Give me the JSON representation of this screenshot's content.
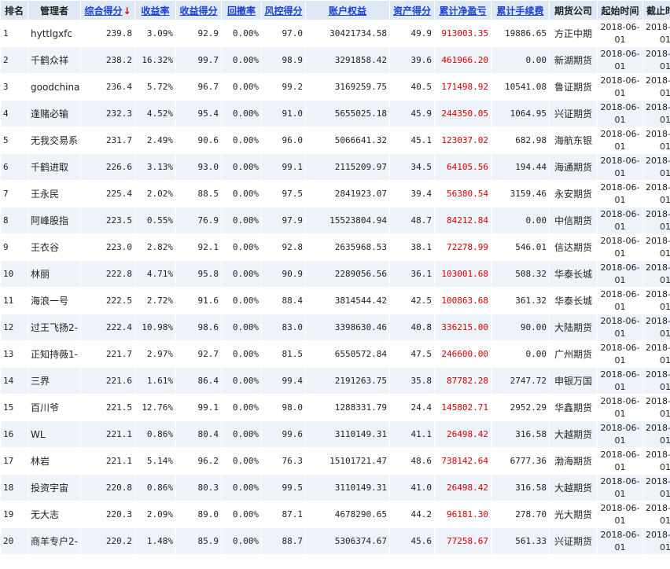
{
  "headers": {
    "rank": "排名",
    "manager": "管理者",
    "score": "综合得分",
    "sort_arrow": "↓",
    "return": "收益率",
    "return_score": "收益得分",
    "drawdown": "回撤率",
    "risk_score": "风控得分",
    "equity": "账户权益",
    "asset_score": "资产得分",
    "net_profit": "累计净盈亏",
    "fees": "累计手续费",
    "company": "期货公司",
    "start": "起始时间",
    "end": "截止时间"
  },
  "rows": [
    {
      "rank": "1",
      "manager": "hyttlgxfc",
      "score": "239.8",
      "ret": "3.09%",
      "ret_score": "92.9",
      "dd": "0.00%",
      "risk": "97.0",
      "equity": "30421734.58",
      "asset": "49.9",
      "profit": "913003.35",
      "fee": "19886.65",
      "company": "方正中期",
      "start": "2018-06-01",
      "end": "2018-06-01"
    },
    {
      "rank": "2",
      "manager": "千鹤众祥",
      "score": "238.2",
      "ret": "16.32%",
      "ret_score": "99.7",
      "dd": "0.00%",
      "risk": "98.9",
      "equity": "3291858.42",
      "asset": "39.6",
      "profit": "461966.20",
      "fee": "0.00",
      "company": "新湖期货",
      "start": "2018-06-01",
      "end": "2018-06-01"
    },
    {
      "rank": "3",
      "manager": "goodchinas",
      "score": "236.4",
      "ret": "5.72%",
      "ret_score": "96.7",
      "dd": "0.00%",
      "risk": "99.2",
      "equity": "3169259.75",
      "asset": "40.5",
      "profit": "171498.92",
      "fee": "10541.08",
      "company": "鲁证期货",
      "start": "2018-06-01",
      "end": "2018-06-01"
    },
    {
      "rank": "4",
      "manager": "逢赌必输",
      "score": "232.3",
      "ret": "4.52%",
      "ret_score": "95.4",
      "dd": "0.00%",
      "risk": "91.0",
      "equity": "5655025.18",
      "asset": "45.9",
      "profit": "244350.05",
      "fee": "1064.95",
      "company": "兴证期货",
      "start": "2018-06-01",
      "end": "2018-06-01"
    },
    {
      "rank": "5",
      "manager": "无我交易系",
      "score": "231.7",
      "ret": "2.49%",
      "ret_score": "90.6",
      "dd": "0.00%",
      "risk": "96.0",
      "equity": "5066641.32",
      "asset": "45.1",
      "profit": "123037.02",
      "fee": "682.98",
      "company": "海航东银",
      "start": "2018-06-01",
      "end": "2018-06-01"
    },
    {
      "rank": "6",
      "manager": "千鹤进取",
      "score": "226.6",
      "ret": "3.13%",
      "ret_score": "93.0",
      "dd": "0.00%",
      "risk": "99.1",
      "equity": "2115209.97",
      "asset": "34.5",
      "profit": "64105.56",
      "fee": "194.44",
      "company": "海通期货",
      "start": "2018-06-01",
      "end": "2018-06-01"
    },
    {
      "rank": "7",
      "manager": "王永民",
      "score": "225.4",
      "ret": "2.02%",
      "ret_score": "88.5",
      "dd": "0.00%",
      "risk": "97.5",
      "equity": "2841923.07",
      "asset": "39.4",
      "profit": "56380.54",
      "fee": "3159.46",
      "company": "永安期货",
      "start": "2018-06-01",
      "end": "2018-06-01"
    },
    {
      "rank": "8",
      "manager": "阿峰股指",
      "score": "223.5",
      "ret": "0.55%",
      "ret_score": "76.9",
      "dd": "0.00%",
      "risk": "97.9",
      "equity": "15523804.94",
      "asset": "48.7",
      "profit": "84212.84",
      "fee": "0.00",
      "company": "中信期货",
      "start": "2018-06-01",
      "end": "2018-06-01"
    },
    {
      "rank": "9",
      "manager": "王衣谷",
      "score": "223.0",
      "ret": "2.82%",
      "ret_score": "92.1",
      "dd": "0.00%",
      "risk": "92.8",
      "equity": "2635968.53",
      "asset": "38.1",
      "profit": "72278.99",
      "fee": "546.01",
      "company": "信达期货",
      "start": "2018-06-01",
      "end": "2018-06-01"
    },
    {
      "rank": "10",
      "manager": "林丽",
      "score": "222.8",
      "ret": "4.71%",
      "ret_score": "95.8",
      "dd": "0.00%",
      "risk": "90.9",
      "equity": "2289056.56",
      "asset": "36.1",
      "profit": "103001.68",
      "fee": "508.32",
      "company": "华泰长城",
      "start": "2018-06-01",
      "end": "2018-06-01"
    },
    {
      "rank": "11",
      "manager": "海浪一号",
      "score": "222.5",
      "ret": "2.72%",
      "ret_score": "91.6",
      "dd": "0.00%",
      "risk": "88.4",
      "equity": "3814544.42",
      "asset": "42.5",
      "profit": "100863.68",
      "fee": "361.32",
      "company": "华泰长城",
      "start": "2018-06-01",
      "end": "2018-06-01"
    },
    {
      "rank": "12",
      "manager": "过王飞扬2-",
      "score": "222.4",
      "ret": "10.98%",
      "ret_score": "98.6",
      "dd": "0.00%",
      "risk": "83.0",
      "equity": "3398630.46",
      "asset": "40.8",
      "profit": "336215.00",
      "fee": "90.00",
      "company": "大陆期货",
      "start": "2018-06-01",
      "end": "2018-06-01"
    },
    {
      "rank": "13",
      "manager": "正知持薇1-",
      "score": "221.7",
      "ret": "2.97%",
      "ret_score": "92.7",
      "dd": "0.00%",
      "risk": "81.5",
      "equity": "6550572.84",
      "asset": "47.5",
      "profit": "246600.00",
      "fee": "0.00",
      "company": "广州期货",
      "start": "2018-06-01",
      "end": "2018-06-01"
    },
    {
      "rank": "14",
      "manager": "三界",
      "score": "221.6",
      "ret": "1.61%",
      "ret_score": "86.4",
      "dd": "0.00%",
      "risk": "99.4",
      "equity": "2191263.75",
      "asset": "35.8",
      "profit": "87782.28",
      "fee": "2747.72",
      "company": "申银万国",
      "start": "2018-06-01",
      "end": "2018-06-01"
    },
    {
      "rank": "15",
      "manager": "百川爷",
      "score": "221.5",
      "ret": "12.76%",
      "ret_score": "99.1",
      "dd": "0.00%",
      "risk": "98.0",
      "equity": "1288331.79",
      "asset": "24.4",
      "profit": "145802.71",
      "fee": "2952.29",
      "company": "华鑫期货",
      "start": "2018-06-01",
      "end": "2018-06-01"
    },
    {
      "rank": "16",
      "manager": "WL",
      "score": "221.1",
      "ret": "0.86%",
      "ret_score": "80.4",
      "dd": "0.00%",
      "risk": "99.6",
      "equity": "3110149.31",
      "asset": "41.1",
      "profit": "26498.42",
      "fee": "316.58",
      "company": "大越期货",
      "start": "2018-06-01",
      "end": "2018-06-01"
    },
    {
      "rank": "17",
      "manager": "林岩",
      "score": "221.1",
      "ret": "5.14%",
      "ret_score": "96.2",
      "dd": "0.00%",
      "risk": "76.3",
      "equity": "15101721.47",
      "asset": "48.6",
      "profit": "738142.64",
      "fee": "6777.36",
      "company": "渤海期货",
      "start": "2018-06-01",
      "end": "2018-06-01"
    },
    {
      "rank": "18",
      "manager": "投资宇宙",
      "score": "220.8",
      "ret": "0.86%",
      "ret_score": "80.3",
      "dd": "0.00%",
      "risk": "99.5",
      "equity": "3110149.31",
      "asset": "41.0",
      "profit": "26498.42",
      "fee": "316.58",
      "company": "大越期货",
      "start": "2018-06-01",
      "end": "2018-06-01"
    },
    {
      "rank": "19",
      "manager": "无大志",
      "score": "220.3",
      "ret": "2.09%",
      "ret_score": "89.0",
      "dd": "0.00%",
      "risk": "87.1",
      "equity": "4678290.65",
      "asset": "44.2",
      "profit": "96181.30",
      "fee": "278.70",
      "company": "光大期货",
      "start": "2018-06-01",
      "end": "2018-06-01"
    },
    {
      "rank": "20",
      "manager": "商羊专户2-",
      "score": "220.2",
      "ret": "1.48%",
      "ret_score": "85.9",
      "dd": "0.00%",
      "risk": "88.7",
      "equity": "5306374.67",
      "asset": "45.6",
      "profit": "77258.67",
      "fee": "561.33",
      "company": "兴证期货",
      "start": "2018-06-01",
      "end": "2018-06-01"
    }
  ]
}
